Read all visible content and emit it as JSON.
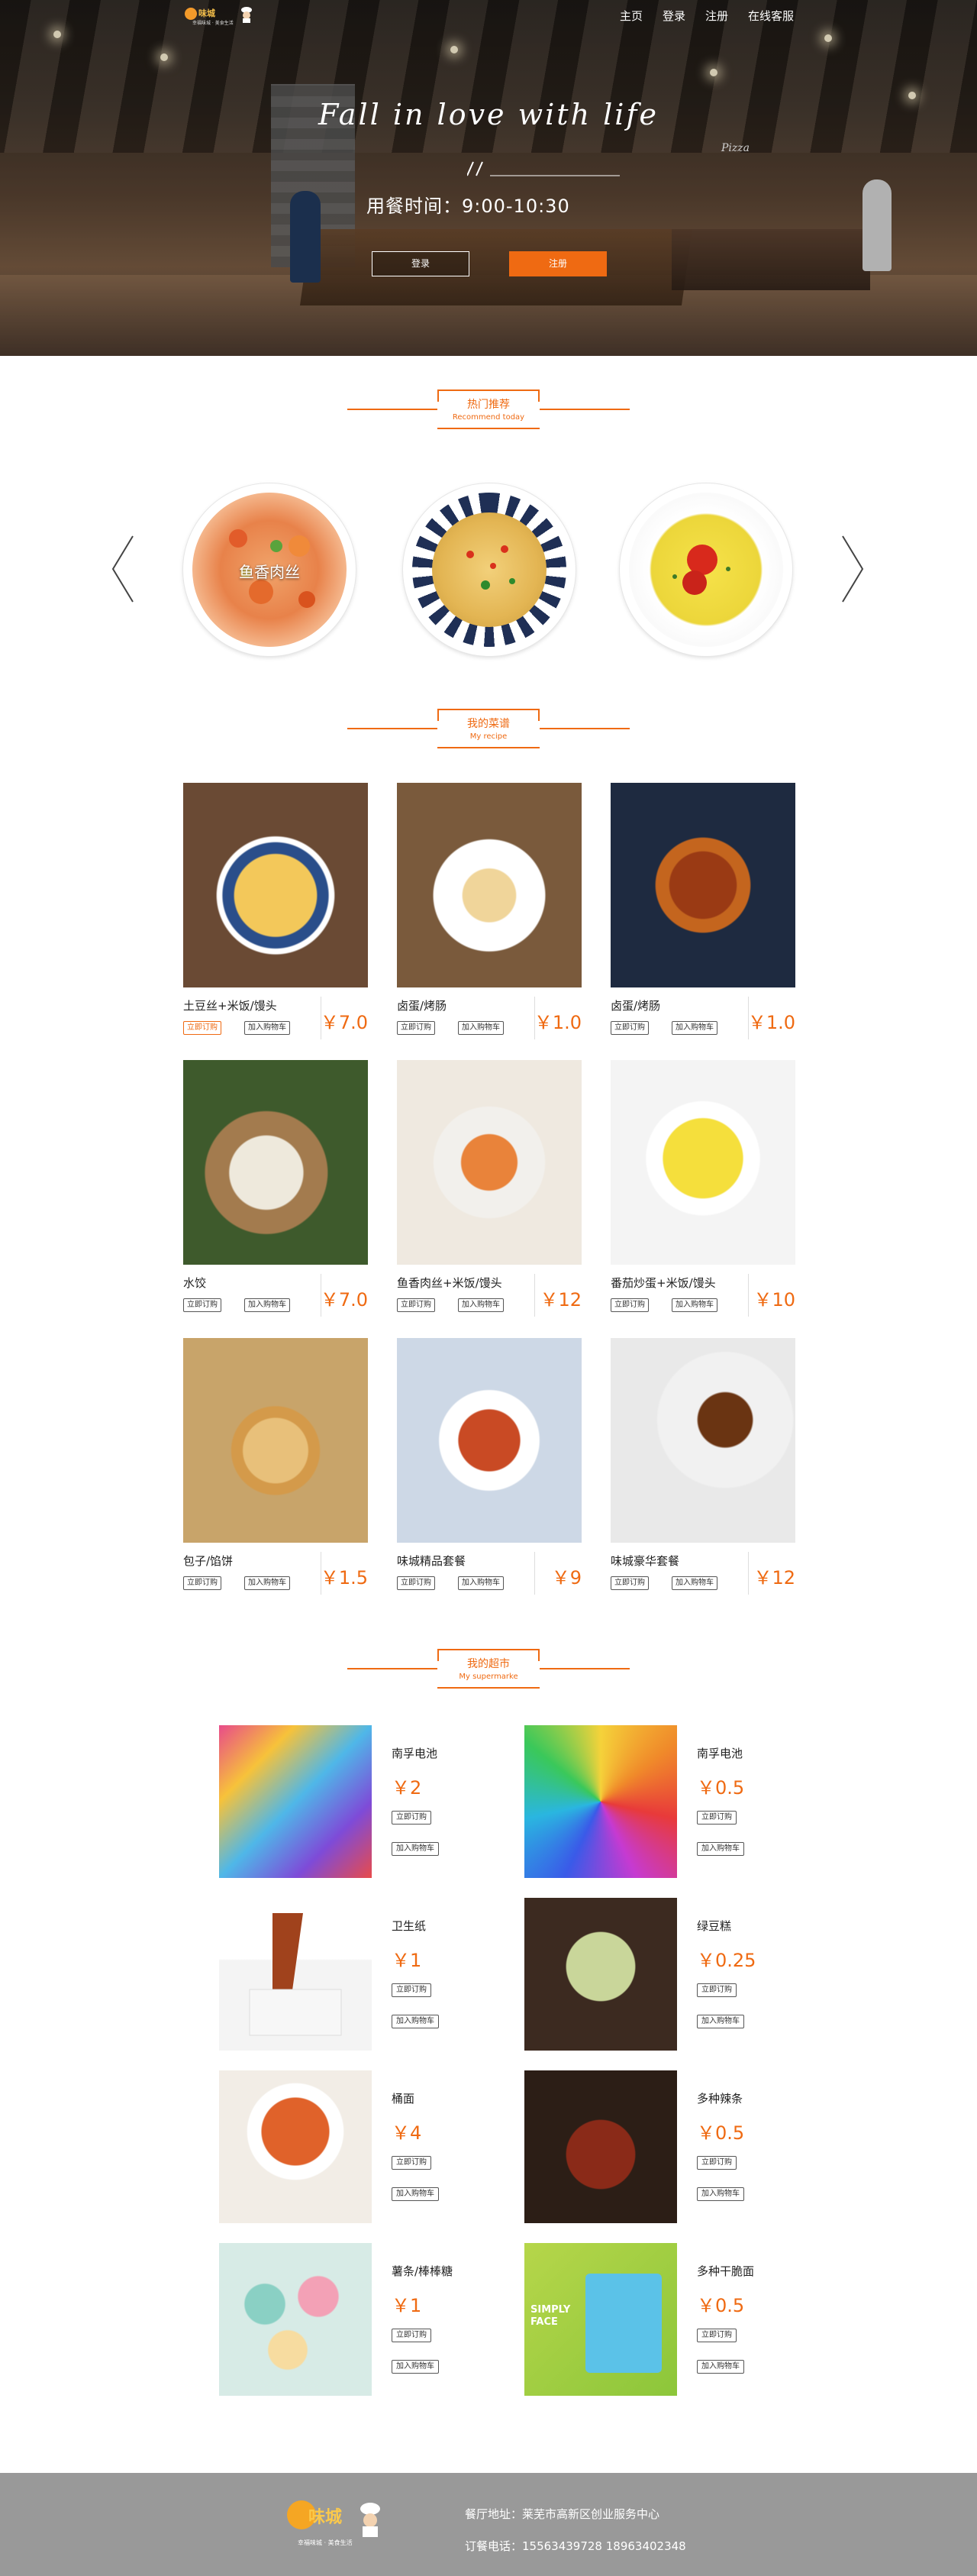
{
  "header": {
    "brand": "味城",
    "brand_tagline": "幸福味城 · 美食生活",
    "nav": [
      "主页",
      "登录",
      "注册",
      "在线客服"
    ]
  },
  "hero": {
    "title": "Fall in love with life",
    "sign": "Pizza",
    "hours": "用餐时间：9:00-10:30",
    "login_label": "登录",
    "register_label": "注册"
  },
  "sections": {
    "recommend": {
      "cn": "热门推荐",
      "en": "Recommend today"
    },
    "recipe": {
      "cn": "我的菜谱",
      "en": "My recipe"
    },
    "supermarket": {
      "cn": "我的超市",
      "en": "My supermarke"
    }
  },
  "carousel": {
    "items": [
      {
        "label": "鱼香肉丝",
        "icon": "fish-flavored-pork-dish"
      },
      {
        "label": "",
        "icon": "potato-noodle-dish"
      },
      {
        "label": "",
        "icon": "tomato-egg-dish"
      }
    ]
  },
  "recipes": [
    {
      "name": "土豆丝+米饭/馒头",
      "price": "￥7.0",
      "order": "立即订购",
      "cart": "加入购物车",
      "active": true
    },
    {
      "name": "卤蛋/烤肠",
      "price": "￥1.0",
      "order": "立即订购",
      "cart": "加入购物车",
      "active": false
    },
    {
      "name": "卤蛋/烤肠",
      "price": "￥1.0",
      "order": "立即订购",
      "cart": "加入购物车",
      "active": false
    },
    {
      "name": "水饺",
      "price": "￥7.0",
      "order": "立即订购",
      "cart": "加入购物车",
      "active": false
    },
    {
      "name": "鱼香肉丝+米饭/馒头",
      "price": "￥12",
      "order": "立即订购",
      "cart": "加入购物车",
      "active": false
    },
    {
      "name": "番茄炒蛋+米饭/馒头",
      "price": "￥10",
      "order": "立即订购",
      "cart": "加入购物车",
      "active": false
    },
    {
      "name": "包子/馅饼",
      "price": "￥1.5",
      "order": "立即订购",
      "cart": "加入购物车",
      "active": false
    },
    {
      "name": "味城精品套餐",
      "price": "￥9",
      "order": "立即订购",
      "cart": "加入购物车",
      "active": false
    },
    {
      "name": "味城豪华套餐",
      "price": "￥12",
      "order": "立即订购",
      "cart": "加入购物车",
      "active": false
    }
  ],
  "supermarket": [
    {
      "name": "南孚电池",
      "price": "￥2",
      "order": "立即订购",
      "cart": "加入购物车"
    },
    {
      "name": "南孚电池",
      "price": "￥0.5",
      "order": "立即订购",
      "cart": "加入购物车"
    },
    {
      "name": "卫生纸",
      "price": "￥1",
      "order": "立即订购",
      "cart": "加入购物车"
    },
    {
      "name": "绿豆糕",
      "price": "￥0.25",
      "order": "立即订购",
      "cart": "加入购物车"
    },
    {
      "name": "桶面",
      "price": "￥4",
      "order": "立即订购",
      "cart": "加入购物车"
    },
    {
      "name": "多种辣条",
      "price": "￥0.5",
      "order": "立即订购",
      "cart": "加入购物车"
    },
    {
      "name": "薯条/棒棒糖",
      "price": "￥1",
      "order": "立即订购",
      "cart": "加入购物车"
    },
    {
      "name": "多种干脆面",
      "price": "￥0.5",
      "order": "立即订购",
      "cart": "加入购物车"
    }
  ],
  "supermarket_package_text": "SIMPLY FACE",
  "footer": {
    "brand": "味城",
    "tagline": "幸福味城 · 美食生活",
    "address": "餐厅地址：莱芜市高新区创业服务中心",
    "phone": "订餐电话：15563439728    18963402348"
  },
  "colors": {
    "accent": "#ef6a12",
    "footer_bg": "#999999"
  }
}
